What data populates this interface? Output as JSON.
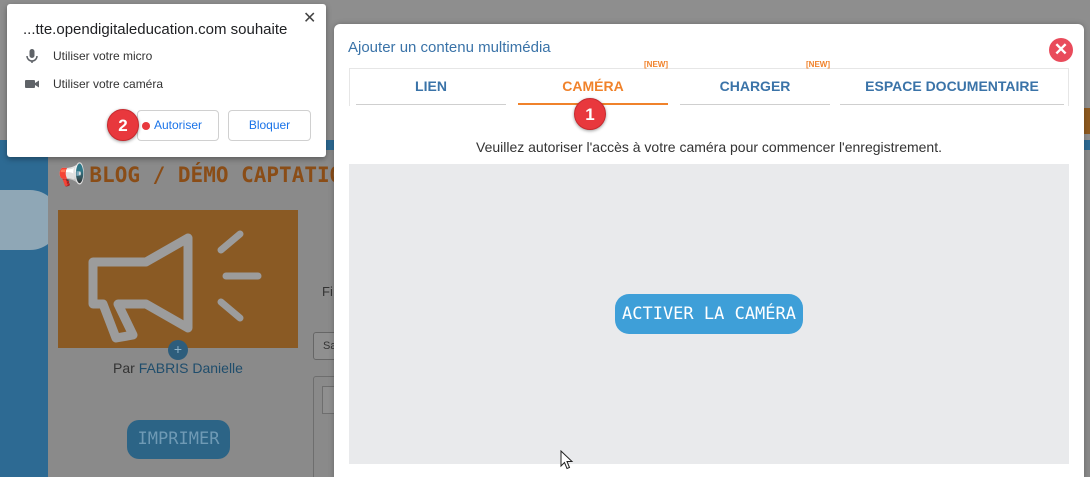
{
  "background": {
    "blog_title": "BLOG / DÉMO CAPTATION",
    "author_prefix": "Par",
    "author_name": "FABRIS Danielle",
    "print_label": "IMPRIMER",
    "filter_stub": "Fi",
    "select_stub": "Sa"
  },
  "modal": {
    "title": "Ajouter un contenu multimédia",
    "tabs": [
      {
        "label": "LIEN",
        "new": ""
      },
      {
        "label": "CAMÉRA",
        "new": "[NEW]"
      },
      {
        "label": "CHARGER",
        "new": "[NEW]"
      },
      {
        "label": "ESPACE DOCUMENTAIRE",
        "new": ""
      }
    ],
    "active_tab": "CAMÉRA",
    "instruction": "Veuillez autoriser l'accès à votre caméra pour commencer l'enregistrement.",
    "activate_label": "ACTIVER LA CAMÉRA"
  },
  "popup": {
    "title": "...tte.opendigitaleducation.com souhaite",
    "permissions": [
      {
        "icon": "microphone-icon",
        "label": "Utiliser votre micro"
      },
      {
        "icon": "camera-icon",
        "label": "Utiliser votre caméra"
      }
    ],
    "allow_label": "Autoriser",
    "block_label": "Bloquer"
  },
  "badges": {
    "step1": "1",
    "step2": "2"
  },
  "colors": {
    "accent_orange": "#f0822b",
    "link_blue": "#3a73a8",
    "badge_red": "#e8383d",
    "button_blue": "#3e9fd8"
  }
}
